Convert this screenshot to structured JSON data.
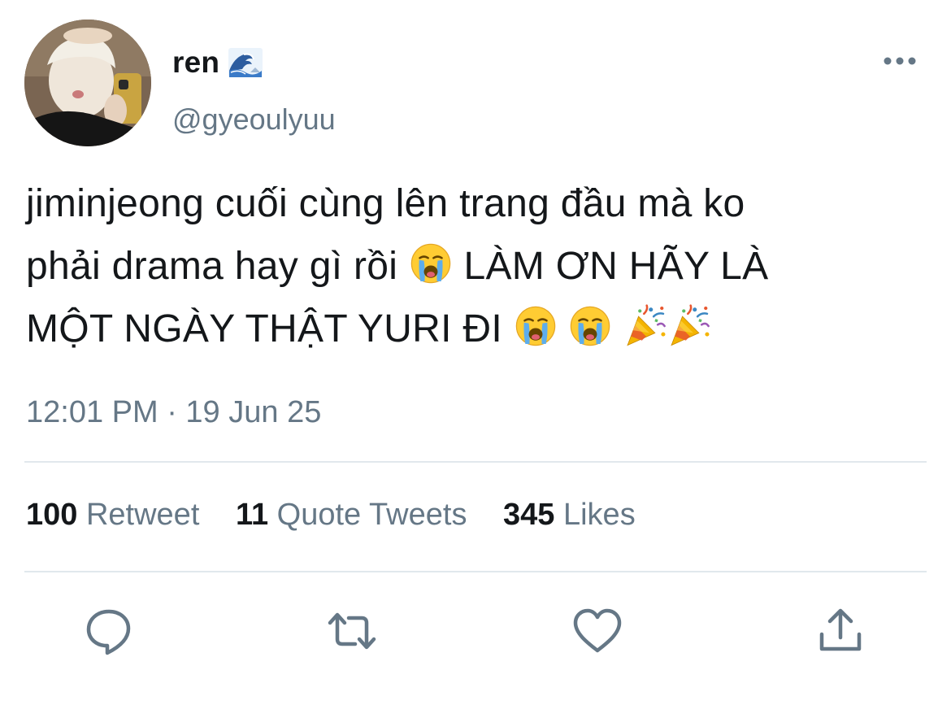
{
  "user": {
    "display_name": "ren",
    "name_emoji": "wave-emoji",
    "handle": "@gyeoulyuu",
    "avatar": "profile-photo"
  },
  "tweet": {
    "line1": "jiminjeong cuối cùng lên trang đầu mà ko",
    "line2_text": "phải drama hay gì rồi ",
    "line2_after": " LÀM ƠN HÃY LÀ",
    "line3_text": "MỘT NGÀY THẬT YURI ĐI ",
    "emojis": [
      "loudly-crying-face",
      "loudly-crying-face",
      "loudly-crying-face",
      "party-popper",
      "party-popper"
    ]
  },
  "meta": {
    "timestamp": "12:01 PM · 19 Jun 25"
  },
  "stats": {
    "retweets_count": "100",
    "retweets_label": "Retweet",
    "quotes_count": "11",
    "quotes_label": "Quote Tweets",
    "likes_count": "345",
    "likes_label": "Likes"
  },
  "actions": [
    "reply-icon",
    "retweet-icon",
    "like-icon",
    "share-icon"
  ],
  "colors": {
    "text": "#14171a",
    "secondary": "#657786",
    "divider": "#e1e8ed"
  }
}
